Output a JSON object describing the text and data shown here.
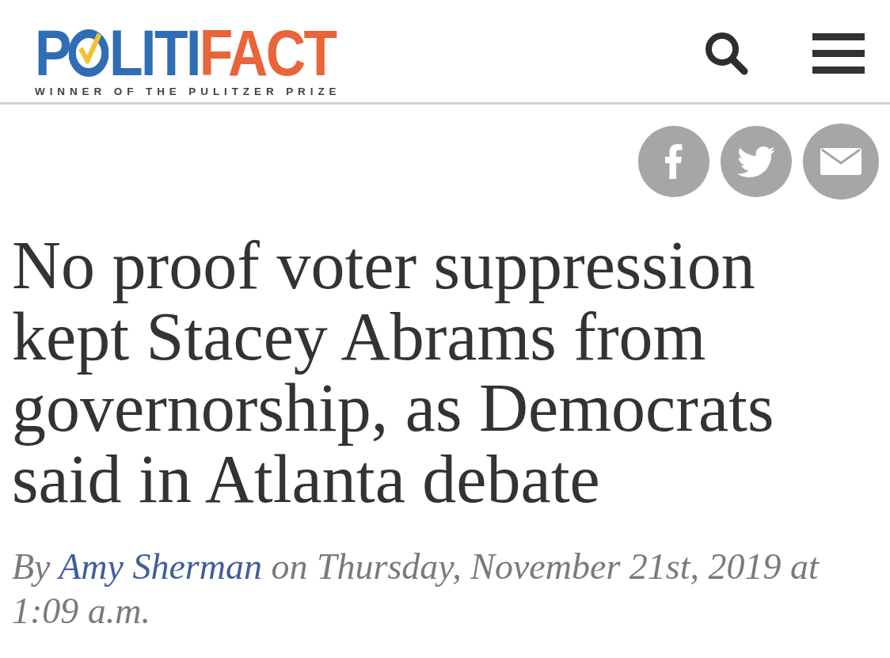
{
  "header": {
    "logo": {
      "lead": "P",
      "middle": "LITI",
      "accent": "FACT",
      "tagline": "WINNER OF THE PULITZER PRIZE"
    }
  },
  "article": {
    "headline": "No proof voter suppression kept Stacey Abrams from governorship, as Democrats said in Atlanta debate",
    "byline": {
      "prefix": "By",
      "author": "Amy Sherman",
      "suffix": "on Thursday, November 21st, 2019 at 1:09 a.m."
    }
  }
}
